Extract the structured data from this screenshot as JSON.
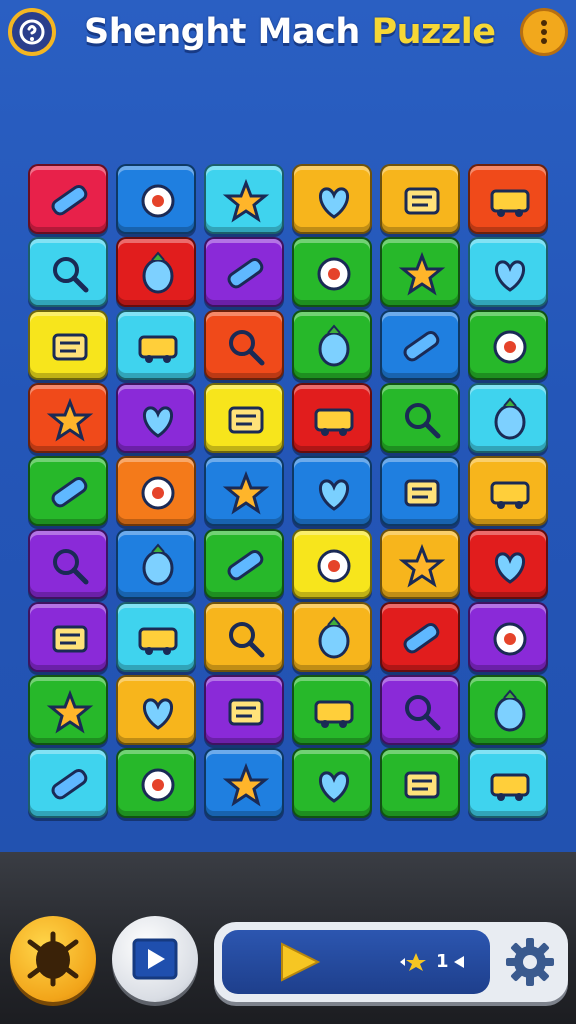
{
  "header": {
    "title_part1": "Shenght Mach ",
    "title_part2": "Puzzle",
    "help_icon": "help-icon",
    "menu_icon": "more-vertical-icon"
  },
  "board": {
    "rows": 9,
    "cols": 6,
    "tile_colors": [
      [
        "#e8214a",
        "#1f7fe0",
        "#3fd3ee",
        "#f7b51c",
        "#f7b51c",
        "#f04a1a"
      ],
      [
        "#3fd3ee",
        "#e11d1d",
        "#8a2ad8",
        "#27b82a",
        "#27b82a",
        "#3fd3ee"
      ],
      [
        "#f7e51c",
        "#3fd3ee",
        "#f04a1a",
        "#27b82a",
        "#1f7fe0",
        "#27b82a"
      ],
      [
        "#f04a1a",
        "#8a2ad8",
        "#f7e51c",
        "#e11d1d",
        "#27b82a",
        "#3fd3ee"
      ],
      [
        "#27b82a",
        "#f47a1a",
        "#1f7fe0",
        "#1f7fe0",
        "#1f7fe0",
        "#f7b51c"
      ],
      [
        "#8a2ad8",
        "#1f7fe0",
        "#27b82a",
        "#f7e51c",
        "#f7b51c",
        "#e11d1d"
      ],
      [
        "#8a2ad8",
        "#3fd3ee",
        "#f7b51c",
        "#f7b51c",
        "#e11d1d",
        "#8a2ad8"
      ],
      [
        "#27b82a",
        "#f7b51c",
        "#8a2ad8",
        "#27b82a",
        "#8a2ad8",
        "#27b82a"
      ],
      [
        "#3fd3ee",
        "#27b82a",
        "#1f7fe0",
        "#27b82a",
        "#27b82a",
        "#3fd3ee"
      ]
    ],
    "tile_icons": [
      [
        "crayon-icon",
        "leaf-icon",
        "droplet-icon",
        "fruit-icon",
        "card-icon",
        "lightbulb-icon"
      ],
      [
        "glasses-icon",
        "cross-bones-icon",
        "pencil-icon",
        "hammer-icon",
        "truck-icon",
        "radio-icon"
      ],
      [
        "ruler-icon",
        "heart-icon",
        "brush-icon",
        "target-icon",
        "magnifier-icon",
        "magnifier-icon"
      ],
      [
        "bus-icon",
        "cake-icon",
        "star-icon",
        "pen-icon",
        "ticket-icon",
        "cheese-icon"
      ],
      [
        "capsule-icon",
        "cart-icon",
        "tv-icon",
        "circle-icon",
        "kite-icon",
        "van-icon"
      ],
      [
        "magnifier-icon",
        "disc-icon",
        "bell-cake-icon",
        "marker-icon",
        "radio-icon",
        "magnet-icon"
      ],
      [
        "heart-icon",
        "scroll-icon",
        "box-icon",
        "bread-icon",
        "timer-icon",
        "lamp-icon"
      ],
      [
        "eraser-icon",
        "lamp-icon",
        "wand-icon",
        "syringe-icon",
        "keypad-icon",
        "star-icon"
      ],
      [
        "pot-icon",
        "sun-icon",
        "ball-icon",
        "planet-icon",
        "alien-icon",
        "van-icon"
      ]
    ]
  },
  "footer": {
    "bug_icon": "bug-icon",
    "play_icon": "play-icon",
    "score_label": "1",
    "settings_icon": "gear-icon"
  }
}
